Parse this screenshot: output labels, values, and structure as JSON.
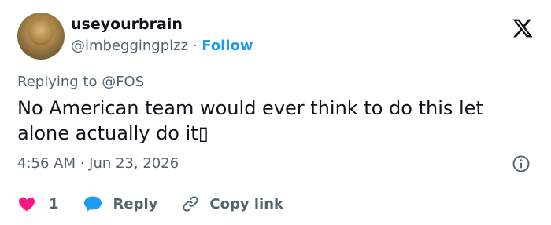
{
  "user": {
    "display_name": "useyourbrain",
    "handle": "@imbeggingplzz",
    "separator": "·",
    "follow_label": "Follow"
  },
  "tweet": {
    "replying_to": "Replying to @FOS",
    "text": "No American team would ever think to do this let alone actually do it▯",
    "timestamp": "4:56 AM · Jun 23, 2026"
  },
  "actions": {
    "like_count": "1",
    "reply_label": "Reply",
    "copy_link_label": "Copy link"
  },
  "icons": {
    "logo": "x-logo-icon",
    "info": "info-icon",
    "like": "heart-icon",
    "reply": "speech-bubble-icon",
    "copy": "link-icon"
  },
  "colors": {
    "link": "#1d9bf0",
    "heart": "#f91880",
    "muted": "#536471",
    "text": "#0f1419"
  }
}
